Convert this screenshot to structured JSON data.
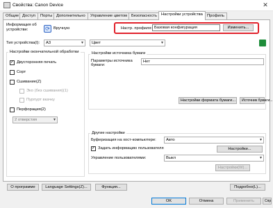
{
  "window": {
    "title": "Свойства: Canon Device",
    "close_glyph": "✕"
  },
  "tabs": [
    "Общие",
    "Доступ",
    "Порты",
    "Дополнительно",
    "Управление цветом",
    "Безопасность",
    "Настройки устройства",
    "Профиль"
  ],
  "device_info": {
    "label": "Информация об устройстве:",
    "mode_label": "Вручную"
  },
  "profile": {
    "label": "Настр. профиля:",
    "value": "Базовая конфигурация",
    "change_button": "Изменить..."
  },
  "device_type": {
    "label": "Тип устройства(I):",
    "value": "А3"
  },
  "color_select": {
    "value": "Цвет"
  },
  "finishing": {
    "title": "Настройки окончательной обработки",
    "duplex": "Двусторонняя печать",
    "collate": "Сорт",
    "stapling": "Сшивание(Z)",
    "eco_stapling": "Эко (без сшивания)(1)",
    "stapling_pos": "Пурпурт вкачку",
    "punch": "Перфорация(2)",
    "punch_select": "2 отверстия"
  },
  "paper_source": {
    "title": "Настройки источника бумаги",
    "params_label": "Параметры источника бумаги:",
    "params_value": "Нет",
    "format_button": "Настройки формата бумаги...",
    "source_button": "Источник бумаги..."
  },
  "other": {
    "title": "Другие настройки",
    "spool_label": "Буферизация на хост-компьютере:",
    "spool_value": "Авто",
    "set_user_info": "Задать информацию пользователя",
    "settings_button": "Настройки...",
    "user_mgmt_label": "Управление пользователями:",
    "user_mgmt_value": "Выкл",
    "settings_disabled": "Настройки(W)..."
  },
  "bottom": {
    "about": "О программе",
    "language": "Language Settings(Z)...",
    "function": "Функция...",
    "details": "Подробно(L)..."
  },
  "dialog": {
    "ok": "OK",
    "cancel": "Отмена",
    "apply": "Применить",
    "help": "Справка"
  }
}
